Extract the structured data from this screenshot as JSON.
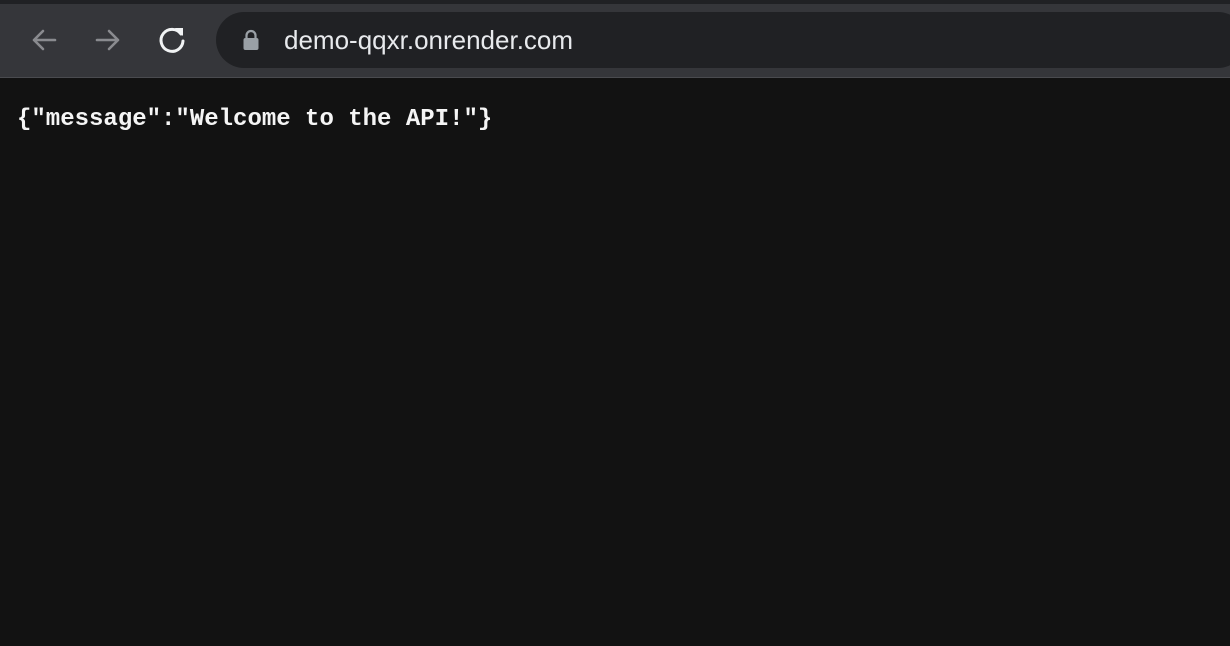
{
  "browser": {
    "url": "demo-qqxr.onrender.com",
    "icons": {
      "back": "arrow-left-icon",
      "forward": "arrow-right-icon",
      "reload": "reload-icon",
      "lock": "lock-icon"
    },
    "colors": {
      "toolbar": "#35363a",
      "omnibox": "#202124",
      "url_text": "#e8eaed",
      "page_background": "#121212"
    }
  },
  "page": {
    "body_text": "{\"message\":\"Welcome to the API!\"}"
  }
}
